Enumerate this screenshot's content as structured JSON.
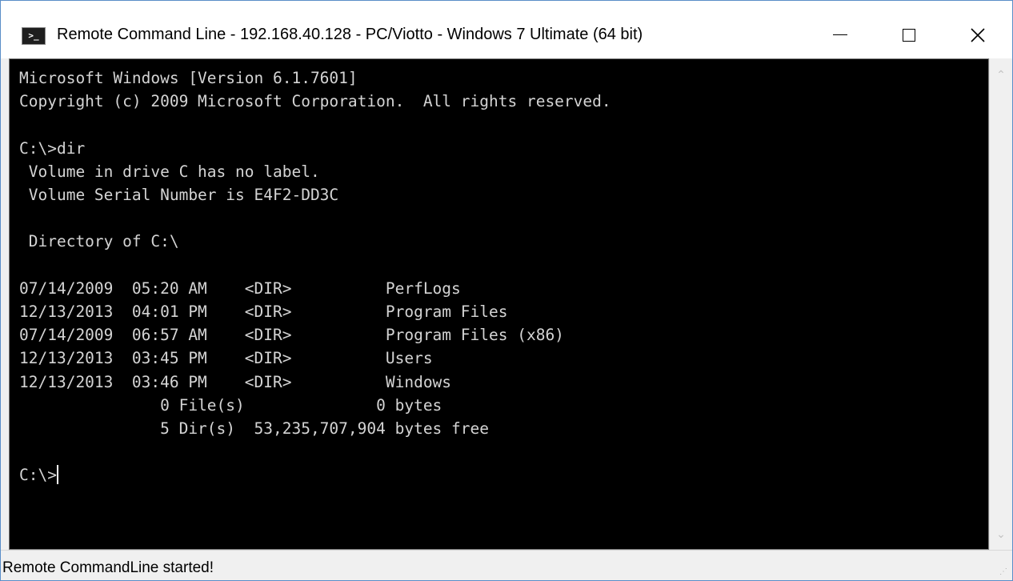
{
  "window": {
    "title": "Remote Command Line - 192.168.40.128 - PC/Viotto - Windows 7 Ultimate (64 bit)",
    "icon_glyph": ">_",
    "icon": "command-prompt-icon",
    "buttons": {
      "minimize": "minimize-icon",
      "maximize": "maximize-icon",
      "close_glyph": "✕"
    }
  },
  "terminal": {
    "lines": [
      "Microsoft Windows [Version 6.1.7601]",
      "Copyright (c) 2009 Microsoft Corporation.  All rights reserved.",
      "",
      "C:\\>dir",
      " Volume in drive C has no label.",
      " Volume Serial Number is E4F2-DD3C",
      "",
      " Directory of C:\\",
      "",
      "07/14/2009  05:20 AM    <DIR>          PerfLogs",
      "12/13/2013  04:01 PM    <DIR>          Program Files",
      "07/14/2009  06:57 AM    <DIR>          Program Files (x86)",
      "12/13/2013  03:45 PM    <DIR>          Users",
      "12/13/2013  03:46 PM    <DIR>          Windows",
      "               0 File(s)              0 bytes",
      "               5 Dir(s)  53,235,707,904 bytes free",
      ""
    ],
    "prompt": "C:\\>"
  },
  "scrollbar": {
    "up_glyph": "⌃",
    "down_glyph": "⌄"
  },
  "status": {
    "text": "Remote CommandLine started!",
    "grip_glyph": "⋰"
  },
  "colors": {
    "terminal_bg": "#000000",
    "terminal_fg": "#d4d4d4",
    "chrome_bg": "#f0f0f0",
    "window_border": "#5a8ec8"
  }
}
